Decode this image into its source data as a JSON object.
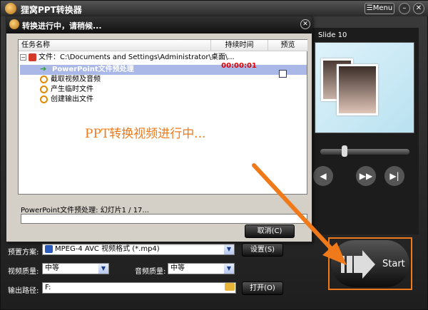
{
  "app": {
    "title": "狸窝PPT转换器",
    "menu_label": "Menu"
  },
  "preview": {
    "slide_label": "Slide 10"
  },
  "dialog": {
    "title": "转换进行中，请稍候...",
    "columns": {
      "name": "任务名称",
      "duration": "持续时间",
      "preview": "预览"
    },
    "file_row": "文件：C:\\Documents and Settings\\Administrator\\桌面\\...",
    "tasks": [
      {
        "label": "PowerPoint文件预处理",
        "duration": "00:00:01",
        "selected": true
      },
      {
        "label": "截取视频及音频"
      },
      {
        "label": "产生临时文件"
      },
      {
        "label": "创建输出文件"
      }
    ],
    "message": "PPT转换视频进行中...",
    "status": "PowerPoint文件预处理: 幻灯片1 / 17...",
    "progress": 0.0,
    "cancel_label": "取消(C)"
  },
  "settings": {
    "preset_label": "预置方案:",
    "preset_value": "MPEG-4 AVC 视频格式 (*.mp4)",
    "settings_button": "设置(S)",
    "video_quality_label": "视频质量:",
    "video_quality_value": "中等",
    "audio_quality_label": "音频质量:",
    "audio_quality_value": "中等",
    "output_label": "输出路径:",
    "output_value": "F:",
    "open_button": "打开(O)"
  },
  "start": {
    "label": "Start"
  },
  "colors": {
    "accent": "#f07a1a",
    "duration": "#e00000",
    "selection": "#aab8e8"
  }
}
